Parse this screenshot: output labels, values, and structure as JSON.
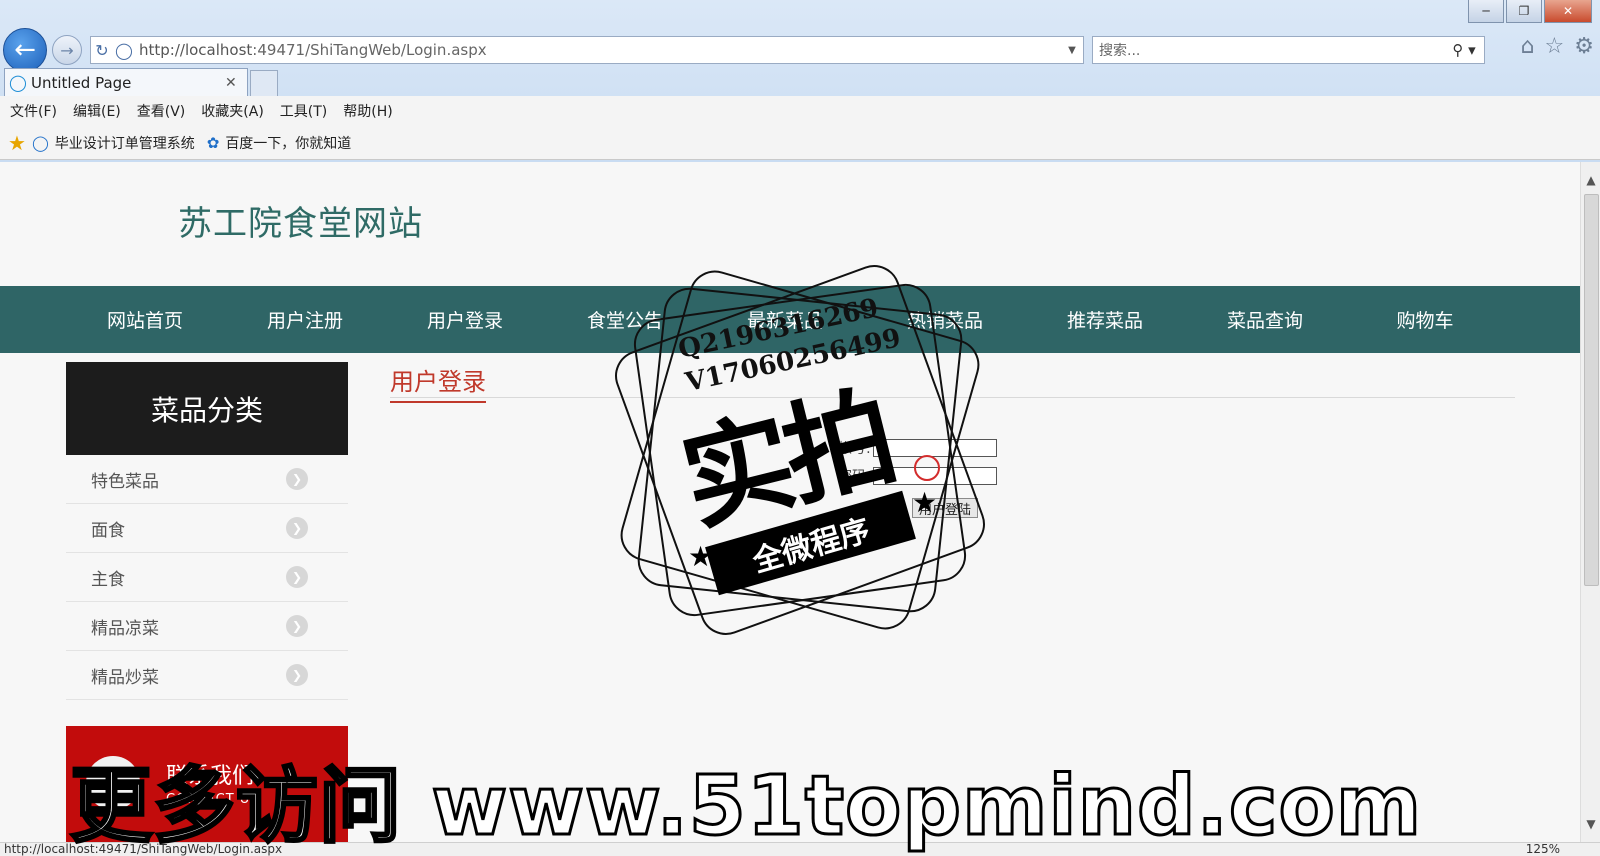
{
  "browser": {
    "url_host": "http://localhost",
    "url_rest": ":49471/ShiTangWeb/Login.aspx",
    "search_placeholder": "搜索...",
    "tab_title": "Untitled Page",
    "menu": [
      "文件(F)",
      "编辑(E)",
      "查看(V)",
      "收藏夹(A)",
      "工具(T)",
      "帮助(H)"
    ],
    "favorites": [
      "毕业设计订单管理系统",
      "百度一下，你就知道"
    ],
    "status_url": "http://localhost:49471/ShiTangWeb/Login.aspx",
    "zoom": "125%"
  },
  "site": {
    "title": "苏工院食堂网站",
    "nav": [
      "网站首页",
      "用户注册",
      "用户登录",
      "食堂公告",
      "最新菜品",
      "热销菜品",
      "推荐菜品",
      "菜品查询",
      "购物车"
    ]
  },
  "sidebar": {
    "heading": "菜品分类",
    "items": [
      "特色菜品",
      "面食",
      "主食",
      "精品凉菜",
      "精品炒菜"
    ],
    "contact_title": "联系我们",
    "contact_sub": "CONTACT US"
  },
  "login": {
    "title": "用户登录",
    "user_label": "帐号:",
    "password_label": "密码:",
    "submit_label": "用户登陆"
  },
  "watermark": {
    "stamp_line1": "Q2196316269",
    "stamp_line2": "V17060256499",
    "stamp_big": "实拍",
    "stamp_ribbon": "全微程序",
    "banner": "更多访问 www.51topmind.com"
  },
  "colors": {
    "nav_bg": "#2f6566",
    "title_color": "#2f6b66",
    "accent_red": "#c0392b",
    "contact_bg": "#c20c0c"
  }
}
